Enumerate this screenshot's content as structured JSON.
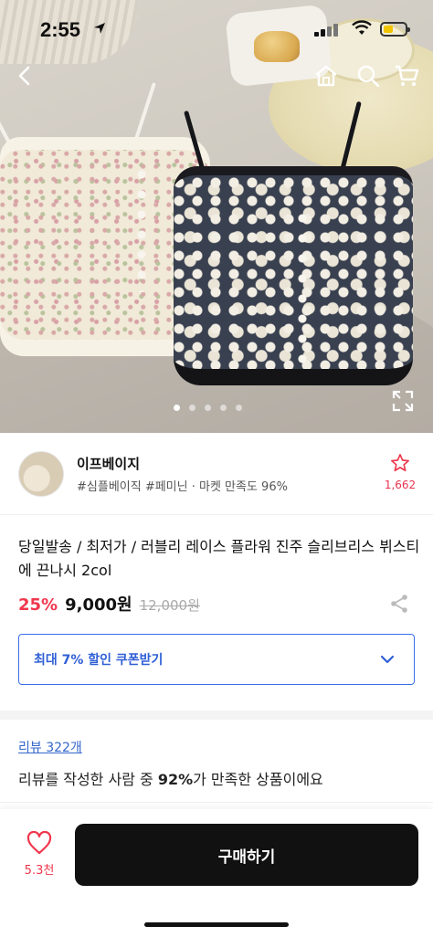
{
  "status_bar": {
    "time": "2:55"
  },
  "gallery": {
    "total_images": 5,
    "active_index": 0
  },
  "shop": {
    "name": "이프베이지",
    "tags": "#심플베이직 #페미닌 · 마켓 만족도 96%",
    "favorite_count": "1,662"
  },
  "product": {
    "title": "당일발송 / 최저가 / 러블리 레이스 플라워 진주 슬리브리스 뷔스티에 끈나시 2col",
    "discount": "25%",
    "price": "9,000원",
    "original_price": "12,000원"
  },
  "coupon": {
    "label": "최대 7% 할인 쿠폰받기"
  },
  "reviews": {
    "link": "리뷰 322개",
    "summary_prefix": "리뷰를 작성한 사람 중 ",
    "summary_percent": "92%",
    "summary_suffix": "가 만족한 상품이에요"
  },
  "bottom": {
    "like_count": "5.3천",
    "buy_label": "구매하기"
  },
  "colors": {
    "accent": "#f0374d",
    "coupon_blue": "#3a6ee8",
    "buy_button": "#111111"
  }
}
